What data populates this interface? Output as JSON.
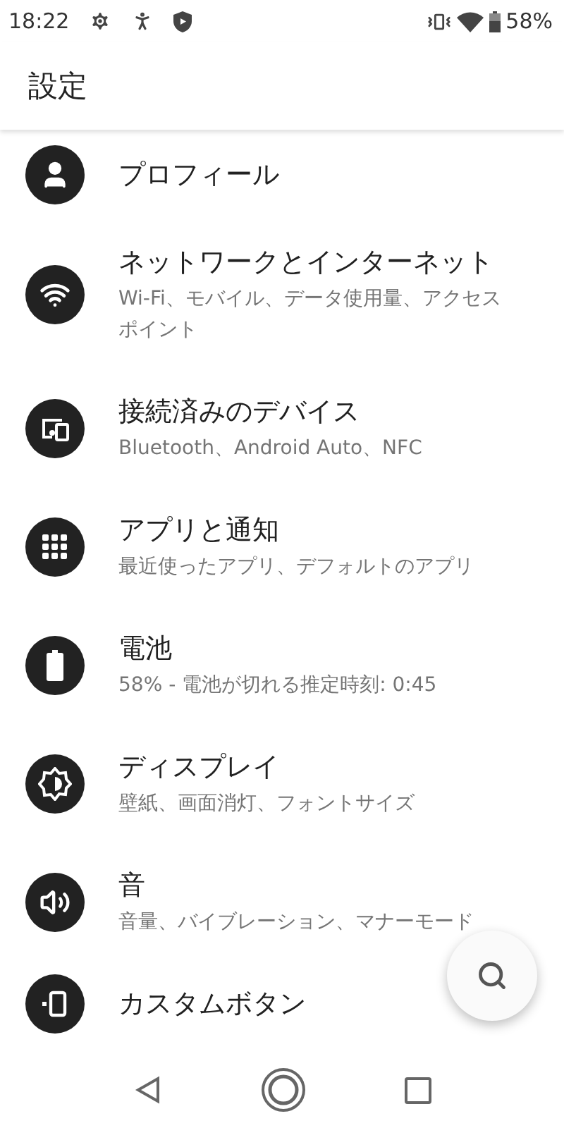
{
  "status_bar": {
    "time": "18:22",
    "battery": "58%"
  },
  "app_bar": {
    "title": "設定"
  },
  "items": [
    {
      "title": "プロフィール"
    },
    {
      "title": "ネットワークとインターネット",
      "subtitle": "Wi-Fi、モバイル、データ使用量、アクセスポイント"
    },
    {
      "title": "接続済みのデバイス",
      "subtitle": "Bluetooth、Android Auto、NFC"
    },
    {
      "title": "アプリと通知",
      "subtitle": "最近使ったアプリ、デフォルトのアプリ"
    },
    {
      "title": "電池",
      "subtitle": "58% - 電池が切れる推定時刻: 0:45"
    },
    {
      "title": "ディスプレイ",
      "subtitle": "壁紙、画面消灯、フォントサイズ"
    },
    {
      "title": "音",
      "subtitle": "音量、バイブレーション、マナーモード"
    },
    {
      "title": "カスタムボタン"
    }
  ]
}
